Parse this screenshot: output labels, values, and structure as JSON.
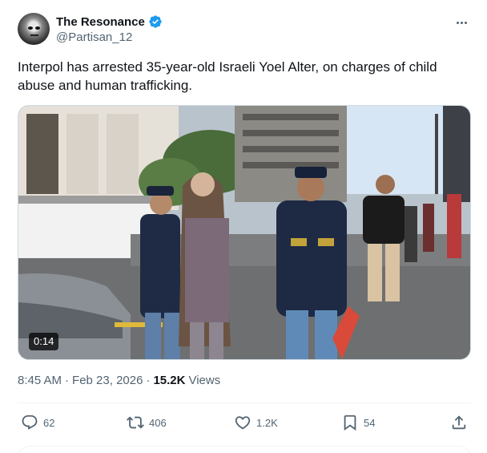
{
  "author": {
    "display_name": "The Resonance",
    "handle": "@Partisan_12",
    "verified": true,
    "avatar_icon": "avatar-image"
  },
  "tweet": {
    "text": "Interpol has arrested 35-year-old Israeli Yoel Alter, on charges of child abuse and human trafficking."
  },
  "media": {
    "type": "video",
    "duration": "0:14"
  },
  "meta": {
    "time": "8:45 AM",
    "date": "Feb 23, 2026",
    "views_count": "15.2K",
    "views_label": "Views",
    "separator": "·"
  },
  "actions": {
    "replies": "62",
    "reposts": "406",
    "likes": "1.2K",
    "bookmarks": "54"
  },
  "colors": {
    "verified_blue": "#1d9bf0",
    "muted_text": "#536471",
    "primary_text": "#0f1419"
  }
}
